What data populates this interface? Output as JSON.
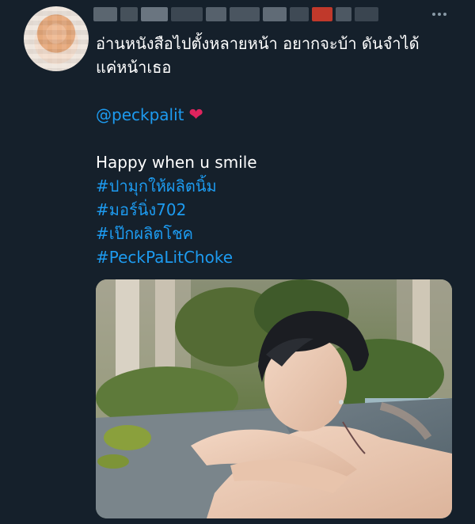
{
  "tweet": {
    "author_name_blurred": "",
    "lines": [
      "อ่านหนังสือไปตั้งหลายหน้า อยากจะบ้า ดันจำได้",
      "แค่หน้าเธอ"
    ],
    "mention": "@peckpalit",
    "emoji": "❤",
    "caption": "Happy when u smile",
    "hashtags": [
      "#ปามุกให้ผลิตนิ้ม",
      "#มอร์นิ่ง702",
      "#เป๊กผลิตโชค",
      "#PeckPaLitChoke"
    ]
  },
  "colors": {
    "background": "#15202b",
    "text": "#ffffff",
    "link": "#1d9bf0",
    "heart": "#e0245e"
  },
  "icons": [
    "more-options-icon",
    "avatar"
  ]
}
